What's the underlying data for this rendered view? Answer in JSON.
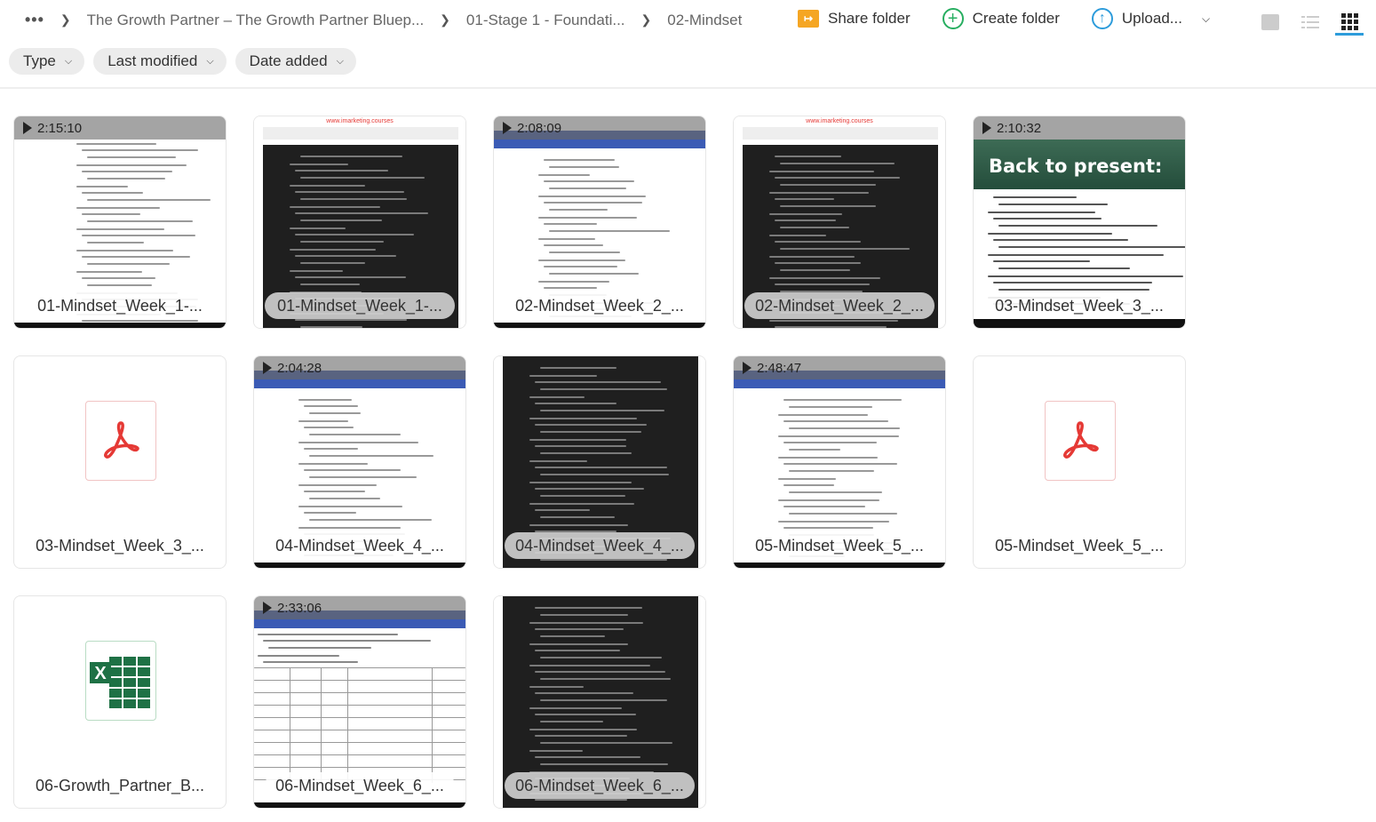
{
  "breadcrumb": {
    "more": "•••",
    "items": [
      "The Growth Partner – The Growth Partner Bluep...",
      "01-Stage 1 - Foundati...",
      "02-Mindset"
    ]
  },
  "actions": {
    "share_folder": "Share folder",
    "create_folder": "Create folder",
    "upload": "Upload..."
  },
  "views": [
    "image-view-icon",
    "list-view-icon",
    "grid-view-icon"
  ],
  "active_view": "grid",
  "filters": [
    "Type",
    "Last modified",
    "Date added"
  ],
  "colors": {
    "accent": "#2d9cdb",
    "share": "#f5a623",
    "create": "#27ae60",
    "pdf": "#e53935",
    "excel": "#1e7145"
  },
  "files": [
    {
      "name": "01-Mindset_Week_1-...",
      "kind": "video",
      "duration": "2:15:10",
      "thumb": "light-doc"
    },
    {
      "name": "01-Mindset_Week_1-...",
      "kind": "doc",
      "thumb": "dark-doc",
      "header": "www.imarketing.courses"
    },
    {
      "name": "02-Mindset_Week_2_...",
      "kind": "video",
      "duration": "2:08:09",
      "thumb": "screen"
    },
    {
      "name": "02-Mindset_Week_2_...",
      "kind": "doc",
      "thumb": "dark-doc",
      "header": "www.imarketing.courses"
    },
    {
      "name": "03-Mindset_Week_3_...",
      "kind": "video",
      "duration": "2:10:32",
      "thumb": "slide",
      "slide_title": "Back to present:"
    },
    {
      "name": "03-Mindset_Week_3_...",
      "kind": "pdf"
    },
    {
      "name": "04-Mindset_Week_4_...",
      "kind": "video",
      "duration": "2:04:28",
      "thumb": "screen"
    },
    {
      "name": "04-Mindset_Week_4_...",
      "kind": "doc",
      "thumb": "dark-doc"
    },
    {
      "name": "05-Mindset_Week_5_...",
      "kind": "video",
      "duration": "2:48:47",
      "thumb": "screen"
    },
    {
      "name": "05-Mindset_Week_5_...",
      "kind": "pdf"
    },
    {
      "name": "06-Growth_Partner_B...",
      "kind": "excel"
    },
    {
      "name": "06-Mindset_Week_6_...",
      "kind": "video",
      "duration": "2:33:06",
      "thumb": "sheet"
    },
    {
      "name": "06-Mindset_Week_6_...",
      "kind": "doc",
      "thumb": "dark-doc"
    }
  ]
}
